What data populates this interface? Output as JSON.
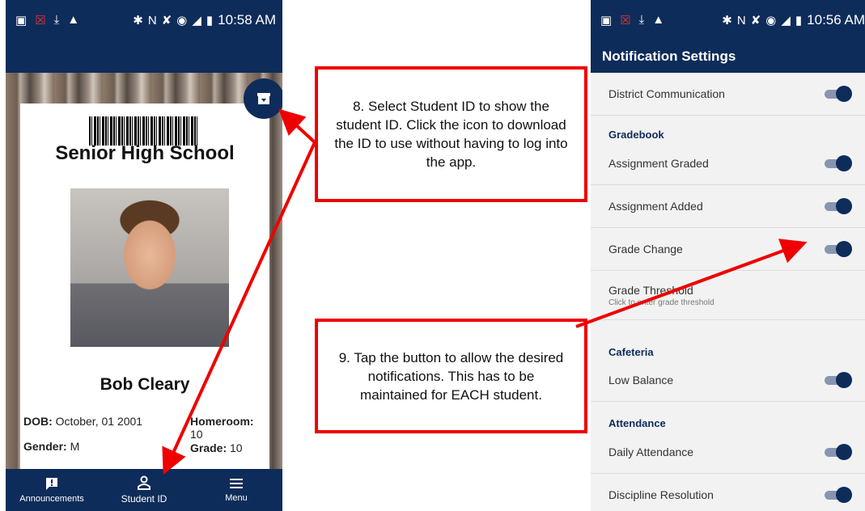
{
  "left_phone": {
    "status": {
      "icons": [
        "inbox-icon",
        "close-box-icon",
        "download-icon",
        "warning-icon"
      ],
      "right_icons": [
        "bluetooth-icon",
        "nfc-icon",
        "mute-icon",
        "wifi-icon",
        "signal-icon",
        "battery-icon"
      ],
      "time": "10:58 AM"
    },
    "card": {
      "school": "Senior High School",
      "student_name": "Bob Cleary",
      "dob_label": "DOB:",
      "dob_value": "October, 01 2001",
      "homeroom_label": "Homeroom:",
      "homeroom_value": "10",
      "gender_label": "Gender:",
      "gender_value": "M",
      "grade_label": "Grade:",
      "grade_value": "10"
    },
    "nav": [
      {
        "label": "Announcements",
        "icon": "announcement-icon"
      },
      {
        "label": "Student ID",
        "icon": "person-icon"
      },
      {
        "label": "Menu",
        "icon": "menu-icon"
      }
    ]
  },
  "right_phone": {
    "status": {
      "time": "10:56 AM"
    },
    "title": "Notification Settings",
    "rows": {
      "district": "District Communication",
      "gradebook_section": "Gradebook",
      "assignment_graded": "Assignment Graded",
      "assignment_added": "Assignment Added",
      "grade_change": "Grade Change",
      "grade_threshold": "Grade Threshold",
      "grade_threshold_sub": "Click to enter grade threshold",
      "cafeteria_section": "Cafeteria",
      "low_balance": "Low Balance",
      "attendance_section": "Attendance",
      "daily_attendance": "Daily Attendance",
      "discipline_resolution": "Discipline Resolution"
    }
  },
  "callouts": {
    "step8": "8. Select Student ID to show the student ID. Click the icon to download the ID to use without having to log into the app.",
    "step9": "9. Tap the button to allow the desired notifications. This has to be maintained for EACH student."
  },
  "colors": {
    "navy": "#0e2c5a",
    "callout_red": "#ee0000"
  }
}
